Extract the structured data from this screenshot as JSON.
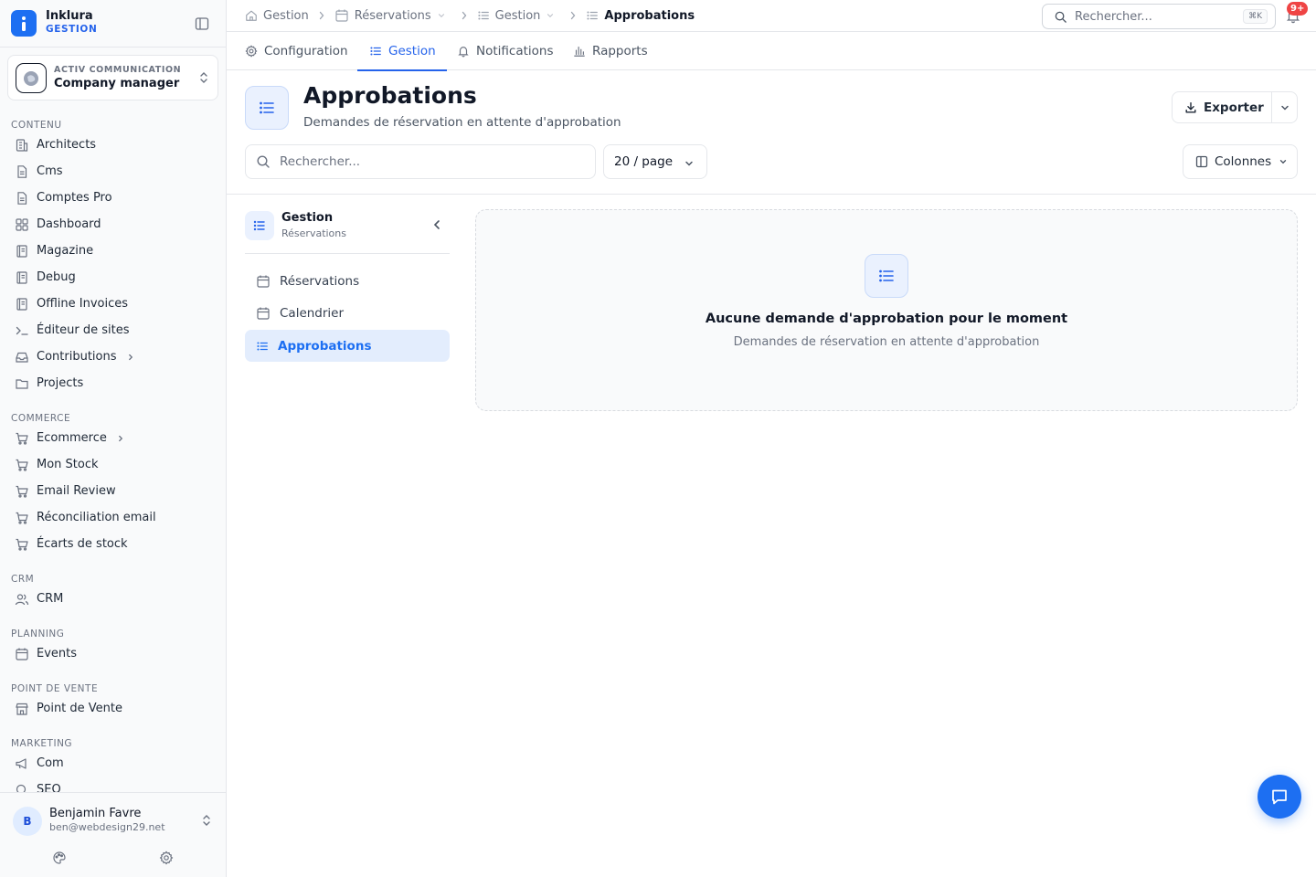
{
  "brand": {
    "name": "Inklura",
    "sub": "GESTION",
    "color": "#1d6ff2"
  },
  "org": {
    "label": "ACTIV COMMUNICATION",
    "name": "Company manager"
  },
  "sidebar": {
    "sections": [
      {
        "title": "CONTENU",
        "items": [
          {
            "label": "Architects",
            "icon": "building-icon"
          },
          {
            "label": "Cms",
            "icon": "file-icon"
          },
          {
            "label": "Comptes Pro",
            "icon": "file-icon"
          },
          {
            "label": "Dashboard",
            "icon": "grid-icon"
          },
          {
            "label": "Magazine",
            "icon": "book-icon"
          },
          {
            "label": "Debug",
            "icon": "book-icon"
          },
          {
            "label": "Offline Invoices",
            "icon": "book-icon"
          },
          {
            "label": "Éditeur de sites",
            "icon": "terminal-icon"
          },
          {
            "label": "Contributions",
            "icon": "inbox-icon",
            "expandable": true
          },
          {
            "label": "Projects",
            "icon": "folder-icon"
          }
        ]
      },
      {
        "title": "COMMERCE",
        "items": [
          {
            "label": "Ecommerce",
            "icon": "cart-icon",
            "expandable": true
          },
          {
            "label": "Mon Stock",
            "icon": "cart-icon"
          },
          {
            "label": "Email Review",
            "icon": "cart-icon"
          },
          {
            "label": "Réconciliation email",
            "icon": "cart-icon"
          },
          {
            "label": "Écarts de stock",
            "icon": "cart-icon"
          }
        ]
      },
      {
        "title": "CRM",
        "items": [
          {
            "label": "CRM",
            "icon": "users-icon"
          }
        ]
      },
      {
        "title": "PLANNING",
        "items": [
          {
            "label": "Events",
            "icon": "calendar-icon"
          }
        ]
      },
      {
        "title": "POINT DE VENTE",
        "items": [
          {
            "label": "Point de Vente",
            "icon": "store-icon"
          }
        ]
      },
      {
        "title": "MARKETING",
        "items": [
          {
            "label": "Com",
            "icon": "megaphone-icon"
          },
          {
            "label": "SEO",
            "icon": "search-icon"
          }
        ]
      }
    ]
  },
  "user": {
    "initial": "B",
    "name": "Benjamin Favre",
    "email": "ben@webdesign29.net"
  },
  "breadcrumb": [
    {
      "label": "Gestion",
      "icon": "home-icon",
      "dropdown": false
    },
    {
      "label": "Réservations",
      "icon": "calendar-icon",
      "dropdown": true
    },
    {
      "label": "Gestion",
      "icon": "list-icon",
      "dropdown": true
    },
    {
      "label": "Approbations",
      "icon": "list-icon",
      "dropdown": false,
      "current": true
    }
  ],
  "topsearch": {
    "placeholder": "Rechercher...",
    "shortcut": "⌘K"
  },
  "notifications": {
    "badge": "9+"
  },
  "tabs": [
    {
      "label": "Configuration",
      "icon": "gear-icon"
    },
    {
      "label": "Gestion",
      "icon": "list-icon",
      "active": true
    },
    {
      "label": "Notifications",
      "icon": "bell-icon"
    },
    {
      "label": "Rapports",
      "icon": "bar-chart-icon"
    }
  ],
  "header": {
    "title": "Approbations",
    "subtitle": "Demandes de réservation en attente d'approbation",
    "export_label": "Exporter"
  },
  "toolbar": {
    "search_placeholder": "Rechercher...",
    "per_page": "20 / page",
    "columns_label": "Colonnes"
  },
  "subnav": {
    "title": "Gestion",
    "subtitle": "Réservations",
    "items": [
      {
        "label": "Réservations",
        "icon": "calendar-icon"
      },
      {
        "label": "Calendrier",
        "icon": "calendar-icon"
      },
      {
        "label": "Approbations",
        "icon": "list-icon",
        "active": true
      }
    ]
  },
  "empty": {
    "title": "Aucune demande d'approbation pour le moment",
    "subtitle": "Demandes de réservation en attente d'approbation"
  },
  "colors": {
    "accent": "#2563eb",
    "badge": "#ef4444",
    "active_bg": "#e3edfd"
  }
}
